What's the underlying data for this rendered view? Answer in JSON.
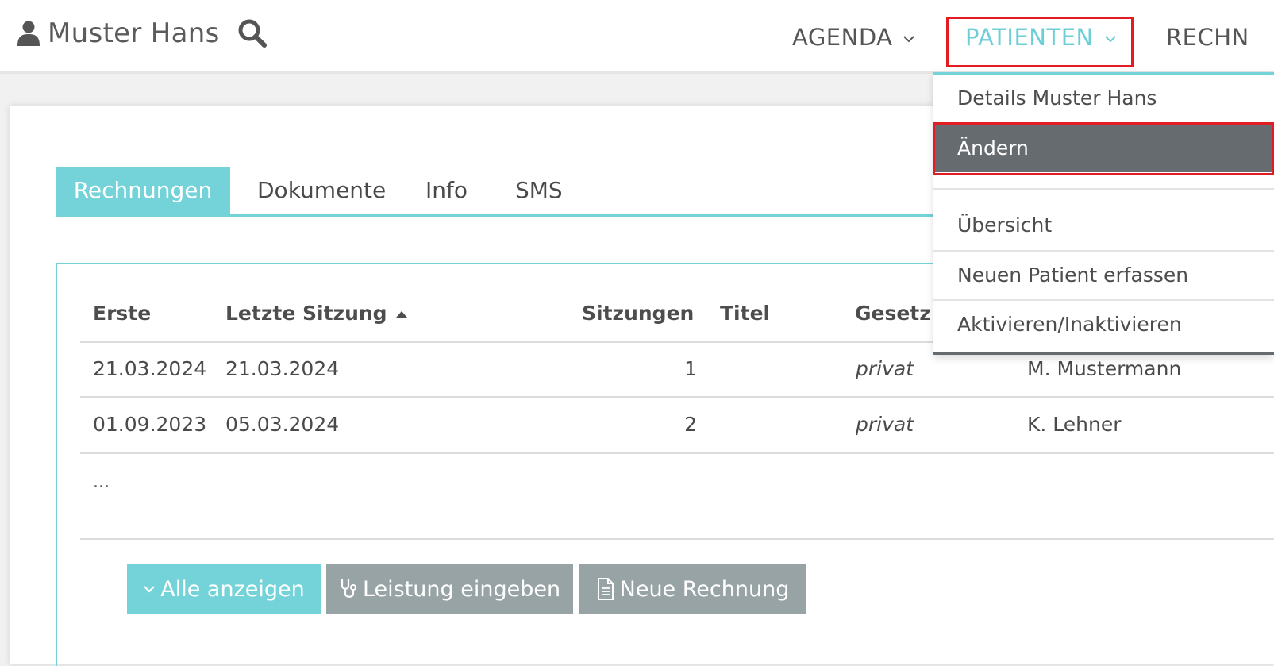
{
  "header": {
    "user_name": "Muster Hans",
    "nav": {
      "agenda": "AGENDA",
      "patienten": "PATIENTEN",
      "rechnungen_partial": "RECHN"
    }
  },
  "patient_menu": {
    "items": [
      "Details Muster Hans",
      "Ändern",
      "Übersicht",
      "Neuen Patient erfassen",
      "Aktivieren/Inaktivieren"
    ],
    "active_item": "Ändern"
  },
  "tabs": {
    "rechnungen": "Rechnungen",
    "dokumente": "Dokumente",
    "info": "Info",
    "sms": "SMS",
    "active": "Rechnungen"
  },
  "table": {
    "columns": {
      "erste": "Erste",
      "letzte_sitzung": "Letzte Sitzung",
      "sitzungen": "Sitzungen",
      "titel": "Titel",
      "gesetz": "Gesetz"
    },
    "rows": [
      {
        "erste": "21.03.2024",
        "letzte": "21.03.2024",
        "sitzungen": "1",
        "gesetz": "privat",
        "person": "M. Mustermann"
      },
      {
        "erste": "01.09.2023",
        "letzte": "05.03.2024",
        "sitzungen": "2",
        "gesetz": "privat",
        "person": "K. Lehner"
      }
    ],
    "more": "..."
  },
  "buttons": {
    "alle_anzeigen": "Alle anzeigen",
    "leistung_eingeben": "Leistung eingeben",
    "neue_rechnung": "Neue Rechnung"
  },
  "colors": {
    "accent": "#74d2d9",
    "highlight": "#e31b23",
    "menu_active": "#666b70",
    "secondary_button": "#97a3a4"
  }
}
